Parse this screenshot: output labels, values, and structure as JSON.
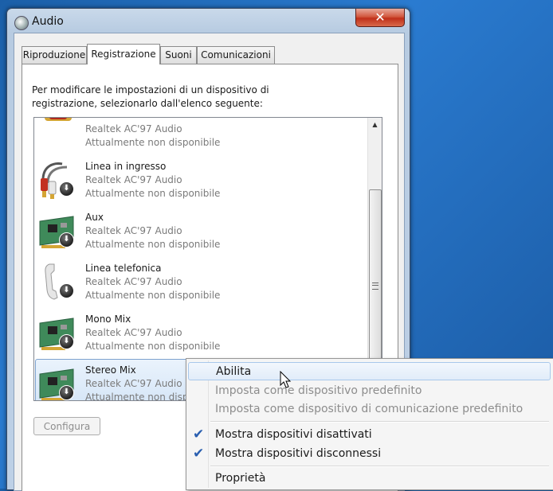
{
  "window": {
    "title": "Audio",
    "close_label": "✕"
  },
  "tabs": [
    {
      "label": "Riproduzione",
      "active": false
    },
    {
      "label": "Registrazione",
      "active": true
    },
    {
      "label": "Suoni",
      "active": false
    },
    {
      "label": "Comunicazioni",
      "active": false
    }
  ],
  "instructions": "Per modificare le impostazioni di un dispositivo di registrazione, selezionarlo dall'elenco seguente:",
  "devices": [
    {
      "name": "",
      "driver": "Realtek AC'97 Audio",
      "status": "Attualmente non disponibile",
      "icon": "rca-connector-icon"
    },
    {
      "name": "Linea in ingresso",
      "driver": "Realtek AC'97 Audio",
      "status": "Attualmente non disponibile",
      "icon": "line-in-cable-icon"
    },
    {
      "name": "Aux",
      "driver": "Realtek AC'97 Audio",
      "status": "Attualmente non disponibile",
      "icon": "sound-card-icon"
    },
    {
      "name": "Linea telefonica",
      "driver": "Realtek AC'97 Audio",
      "status": "Attualmente non disponibile",
      "icon": "telephone-handset-icon"
    },
    {
      "name": "Mono Mix",
      "driver": "Realtek AC'97 Audio",
      "status": "Attualmente non disponibile",
      "icon": "sound-card-icon"
    },
    {
      "name": "Stereo Mix",
      "driver": "Realtek AC'97 Audio",
      "status": "Attualmente non disponibile",
      "icon": "sound-card-icon",
      "selected": true
    }
  ],
  "buttons": {
    "configure": "Configura"
  },
  "context_menu": {
    "items": [
      {
        "label": "Abilita",
        "hover": true,
        "disabled": false,
        "checked": false
      },
      {
        "label": "Imposta come dispositivo predefinito",
        "disabled": true,
        "checked": false
      },
      {
        "label": "Imposta come dispositivo di comunicazione predefinito",
        "disabled": true,
        "checked": false
      },
      {
        "label": "Mostra dispositivi disattivati",
        "disabled": false,
        "checked": true
      },
      {
        "label": "Mostra dispositivi disconnessi",
        "disabled": false,
        "checked": true
      },
      {
        "label": "Proprietà",
        "disabled": false,
        "checked": false
      }
    ],
    "check_glyph": "✔"
  }
}
